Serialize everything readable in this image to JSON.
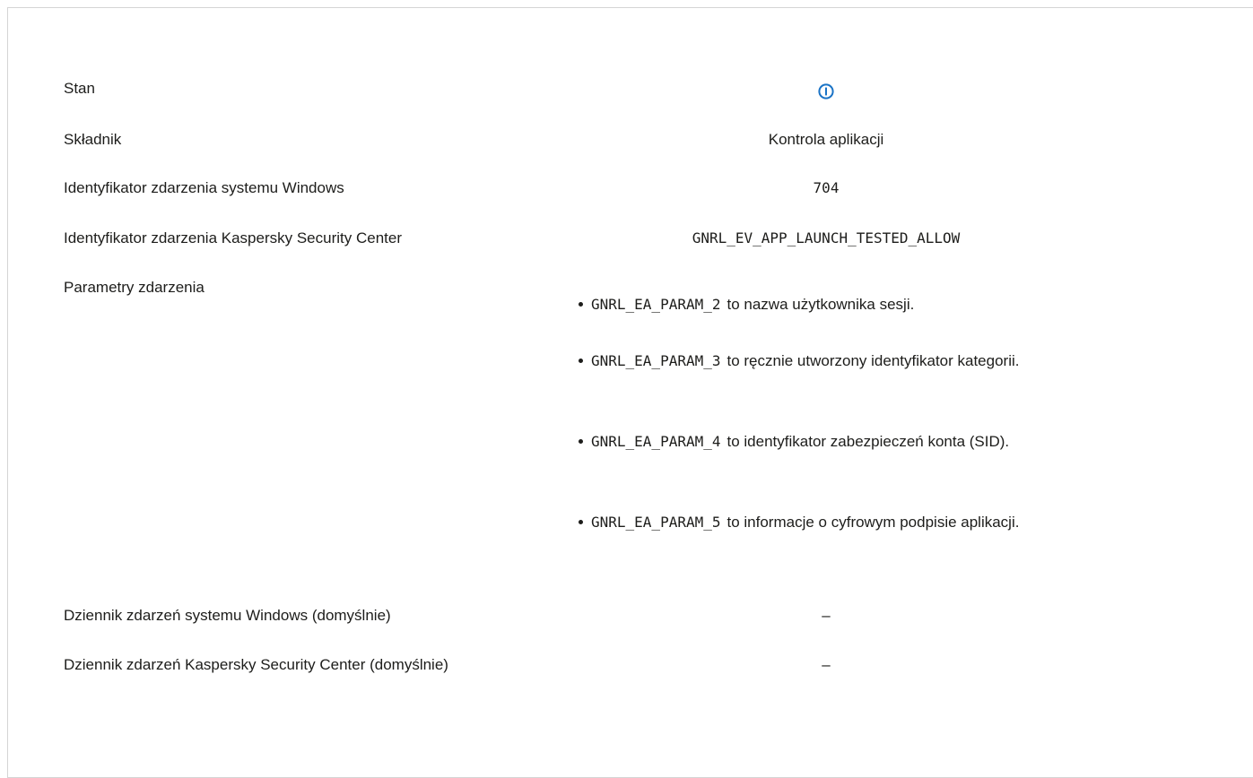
{
  "rows": {
    "status": {
      "label": "Stan",
      "icon": "info-icon"
    },
    "component": {
      "label": "Składnik",
      "value": "Kontrola aplikacji"
    },
    "windows_event_id": {
      "label": "Identyfikator zdarzenia systemu Windows",
      "value": "704"
    },
    "ksc_event_id": {
      "label": "Identyfikator zdarzenia Kaspersky Security Center",
      "value": "GNRL_EV_APP_LAUNCH_TESTED_ALLOW"
    },
    "event_params": {
      "label": "Parametry zdarzenia",
      "items": [
        {
          "name": "GNRL_EA_PARAM_2",
          "text": "to nazwa użytkownika sesji."
        },
        {
          "name": "GNRL_EA_PARAM_3",
          "text": "to ręcznie utworzony identyfikator kategorii."
        },
        {
          "name": "GNRL_EA_PARAM_4",
          "text": "to identyfikator zabezpieczeń konta (SID)."
        },
        {
          "name": "GNRL_EA_PARAM_5",
          "text": "to informacje o cyfrowym podpisie aplikacji."
        }
      ]
    },
    "windows_log": {
      "label": "Dziennik zdarzeń systemu Windows (domyślnie)",
      "value": "–"
    },
    "ksc_log": {
      "label": "Dziennik zdarzeń Kaspersky Security Center (domyślnie)",
      "value": "–"
    }
  },
  "colors": {
    "icon_blue": "#1a73c6",
    "text": "#1d1d1b",
    "border": "#d4d4d4"
  }
}
